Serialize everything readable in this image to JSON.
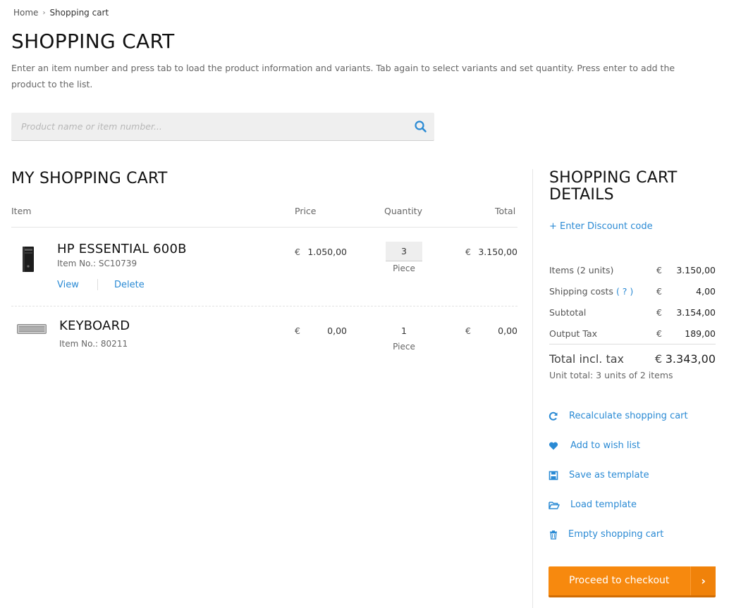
{
  "breadcrumb": {
    "home": "Home",
    "separator": "›",
    "current": "Shopping cart"
  },
  "page_title": "SHOPPING CART",
  "intro": "Enter an item number and press tab to load the product information and variants. Tab again to select variants and set quantity. Press enter to add the product to the list.",
  "search": {
    "placeholder": "Product name or item number...",
    "icon": "search-icon"
  },
  "cart": {
    "heading": "MY SHOPPING CART",
    "columns": {
      "item": "Item",
      "price": "Price",
      "quantity": "Quantity",
      "total": "Total"
    },
    "items": [
      {
        "name": "HP ESSENTIAL 600B",
        "item_no": "Item No.: SC10739",
        "view": "View",
        "delete": "Delete",
        "currency": "€",
        "price": "1.050,00",
        "quantity": "3",
        "unit": "Piece",
        "total": "3.150,00",
        "image": "desktop-tower-image"
      },
      {
        "name": "KEYBOARD",
        "item_no": "Item No.: 80211",
        "currency": "€",
        "price": "0,00",
        "quantity": "1",
        "unit": "Piece",
        "total": "0,00",
        "image": "keyboard-image"
      }
    ]
  },
  "details": {
    "heading": "SHOPPING CART DETAILS",
    "discount": "+ Enter Discount code",
    "currency": "€",
    "lines": [
      {
        "label": "Items (2 units)",
        "value": "3.150,00"
      },
      {
        "label": "Shipping costs",
        "help": "( ? )",
        "value": "4,00"
      },
      {
        "label": "Subtotal",
        "value": "3.154,00"
      },
      {
        "label": "Output Tax",
        "value": "189,00"
      }
    ],
    "total_label": "Total incl. tax",
    "total_value": "3.343,00",
    "unit_total": "Unit total: 3 units of 2 items",
    "actions": [
      {
        "label": "Recalculate shopping cart",
        "icon": "refresh-icon"
      },
      {
        "label": "Add to wish list",
        "icon": "heart-icon"
      },
      {
        "label": "Save as template",
        "icon": "floppy-disk-icon"
      },
      {
        "label": "Load template",
        "icon": "folder-open-icon"
      },
      {
        "label": "Empty shopping cart",
        "icon": "trash-icon"
      }
    ],
    "checkout": "Proceed to checkout",
    "checkout_arrow": "›"
  },
  "colors": {
    "accent": "#2a8ad4",
    "checkout": "#f7890e",
    "text": "#333333"
  }
}
